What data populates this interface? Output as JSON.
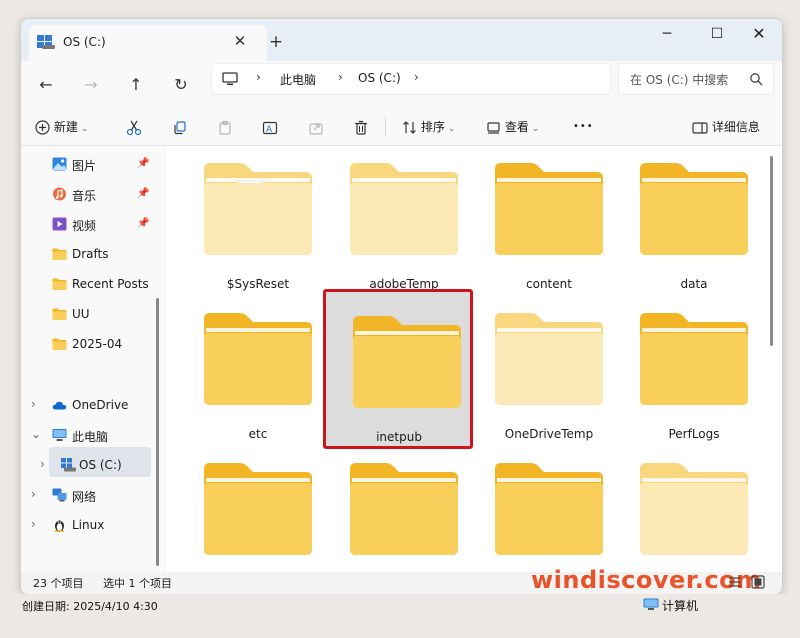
{
  "window": {
    "tab_title": "OS (C:)",
    "tab_close": "✕",
    "new_tab": "+",
    "minimize": "─",
    "maximize": "☐",
    "close": "✕"
  },
  "nav": {
    "back": "←",
    "forward": "→",
    "up": "↑",
    "refresh": "↻",
    "sep": "›",
    "crumbs": [
      "此电脑",
      "OS (C:)"
    ],
    "search_placeholder": "在 OS (C:) 中搜索"
  },
  "toolbar": {
    "new_label": "新建",
    "sort_label": "排序",
    "view_label": "查看",
    "more": "•••",
    "details_label": "详细信息"
  },
  "sidebar": {
    "quick_access": [
      {
        "label": "图片",
        "icon": "pictures-icon",
        "pinned": true
      },
      {
        "label": "音乐",
        "icon": "music-icon",
        "pinned": true
      },
      {
        "label": "视频",
        "icon": "videos-icon",
        "pinned": true
      },
      {
        "label": "Drafts",
        "icon": "folder-icon",
        "pinned": false
      },
      {
        "label": "Recent Posts",
        "icon": "folder-icon",
        "pinned": false
      },
      {
        "label": "UU",
        "icon": "folder-icon",
        "pinned": false
      },
      {
        "label": "2025-04",
        "icon": "folder-icon",
        "pinned": false
      }
    ],
    "onedrive": "OneDrive",
    "this_pc": "此电脑",
    "os_drive": "OS (C:)",
    "network": "网络",
    "linux": "Linux",
    "pin_glyph": "📌",
    "chevron_right": "›",
    "chevron_down": "⌄"
  },
  "content": {
    "folders": [
      {
        "name": "$SysReset",
        "style": "pale-doc"
      },
      {
        "name": "adobeTemp",
        "style": "pale"
      },
      {
        "name": "content",
        "style": "normal"
      },
      {
        "name": "data",
        "style": "normal"
      },
      {
        "name": "etc",
        "style": "normal"
      },
      {
        "name": "inetpub",
        "style": "normal",
        "selected": true
      },
      {
        "name": "OneDriveTemp",
        "style": "pale"
      },
      {
        "name": "PerfLogs",
        "style": "normal"
      },
      {
        "name": "",
        "style": "normal"
      },
      {
        "name": "",
        "style": "normal"
      },
      {
        "name": "",
        "style": "normal"
      },
      {
        "name": "",
        "style": "pale"
      }
    ]
  },
  "status": {
    "item_count": "23 个项目",
    "selected_count": "选中 1 个项目",
    "watermark": "windiscover.com"
  },
  "bottom": {
    "created_date": "创建日期: 2025/4/10 4:30",
    "computer_label": "计算机"
  },
  "colors": {
    "folder_front": "#f9cf5b",
    "folder_back": "#f2b526",
    "pale_front": "#fde9b5",
    "pale_back": "#f8d77f",
    "selection_border": "#d0121b",
    "watermark": "#e8532a"
  }
}
